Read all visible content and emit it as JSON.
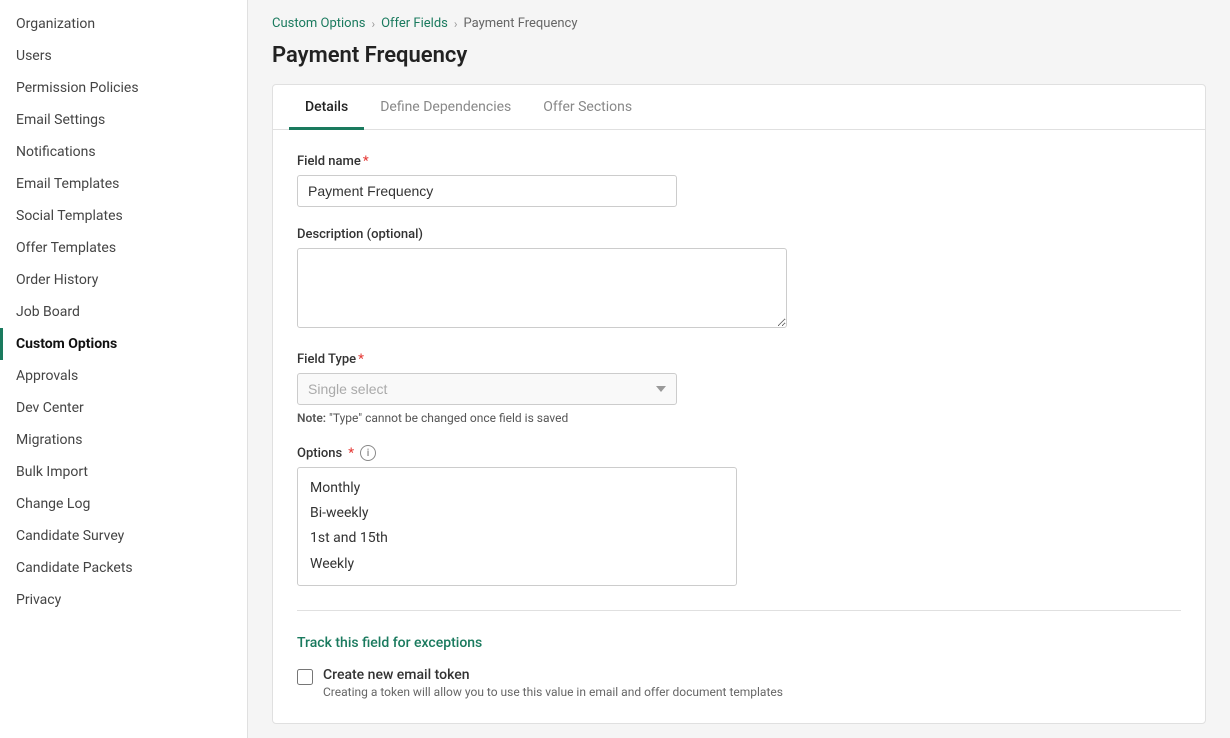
{
  "sidebar": {
    "items": [
      {
        "label": "Organization",
        "id": "organization",
        "active": false
      },
      {
        "label": "Users",
        "id": "users",
        "active": false
      },
      {
        "label": "Permission Policies",
        "id": "permission-policies",
        "active": false
      },
      {
        "label": "Email Settings",
        "id": "email-settings",
        "active": false
      },
      {
        "label": "Notifications",
        "id": "notifications",
        "active": false
      },
      {
        "label": "Email Templates",
        "id": "email-templates",
        "active": false
      },
      {
        "label": "Social Templates",
        "id": "social-templates",
        "active": false
      },
      {
        "label": "Offer Templates",
        "id": "offer-templates",
        "active": false
      },
      {
        "label": "Order History",
        "id": "order-history",
        "active": false
      },
      {
        "label": "Job Board",
        "id": "job-board",
        "active": false
      },
      {
        "label": "Custom Options",
        "id": "custom-options",
        "active": true
      },
      {
        "label": "Approvals",
        "id": "approvals",
        "active": false
      },
      {
        "label": "Dev Center",
        "id": "dev-center",
        "active": false
      },
      {
        "label": "Migrations",
        "id": "migrations",
        "active": false
      },
      {
        "label": "Bulk Import",
        "id": "bulk-import",
        "active": false
      },
      {
        "label": "Change Log",
        "id": "change-log",
        "active": false
      },
      {
        "label": "Candidate Survey",
        "id": "candidate-survey",
        "active": false
      },
      {
        "label": "Candidate Packets",
        "id": "candidate-packets",
        "active": false
      },
      {
        "label": "Privacy",
        "id": "privacy",
        "active": false
      }
    ]
  },
  "breadcrumb": {
    "items": [
      {
        "label": "Custom Options",
        "link": true
      },
      {
        "label": "Offer Fields",
        "link": true
      },
      {
        "label": "Payment Frequency",
        "link": false
      }
    ]
  },
  "page": {
    "title": "Payment Frequency",
    "tabs": [
      {
        "label": "Details",
        "active": true
      },
      {
        "label": "Define Dependencies",
        "active": false
      },
      {
        "label": "Offer Sections",
        "active": false
      }
    ],
    "form": {
      "field_name_label": "Field name",
      "field_name_value": "Payment Frequency",
      "description_label": "Description (optional)",
      "description_placeholder": "",
      "field_type_label": "Field Type",
      "field_type_placeholder": "Single select",
      "note_bold": "Note:",
      "note_text": " \"Type\" cannot be changed once field is saved",
      "options_label": "Options",
      "options_info": "i",
      "options": [
        "Monthly",
        "Bi-weekly",
        "1st and 15th",
        "Weekly"
      ],
      "track_link": "Track this field for exceptions",
      "checkbox_label": "Create new email token",
      "checkbox_desc": "Creating a token will allow you to use this value in email and offer document templates"
    }
  }
}
